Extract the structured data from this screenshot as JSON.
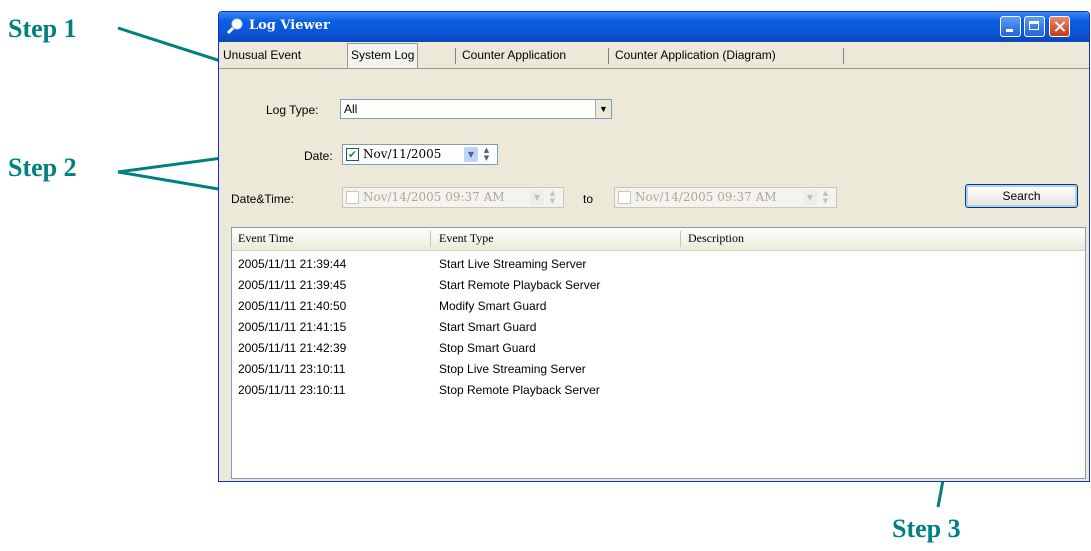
{
  "annotations": {
    "step1": "Step 1",
    "step2": "Step 2",
    "step3": "Step 3",
    "arrow_color": "#008080"
  },
  "window": {
    "title": "Log Viewer",
    "icon": "log-viewer-icon"
  },
  "tabs": [
    {
      "label": "Unusual Event"
    },
    {
      "label": "System Log"
    },
    {
      "label": "Counter Application"
    },
    {
      "label": "Counter Application (Diagram)"
    }
  ],
  "form": {
    "log_type_label": "Log Type:",
    "log_type_value": "All",
    "date_label": "Date:",
    "date_value": "Nov/11/2005",
    "datetime_label": "Date&Time:",
    "datetime_from": "Nov/14/2005 09:37 AM",
    "to_label": "to",
    "datetime_to": "Nov/14/2005 09:37 AM",
    "search_button": "Search"
  },
  "list": {
    "columns": [
      "Event Time",
      "Event Type",
      "Description"
    ],
    "rows": [
      [
        "2005/11/11 21:39:44",
        "Start Live Streaming Server",
        ""
      ],
      [
        "2005/11/11 21:39:45",
        "Start Remote Playback Server",
        ""
      ],
      [
        "2005/11/11 21:40:50",
        "Modify Smart Guard",
        ""
      ],
      [
        "2005/11/11 21:41:15",
        "Start Smart Guard",
        ""
      ],
      [
        "2005/11/11 21:42:39",
        "Stop Smart Guard",
        ""
      ],
      [
        "2005/11/11 23:10:11",
        "Stop Live Streaming Server",
        ""
      ],
      [
        "2005/11/11 23:10:11",
        "Stop Remote Playback Server",
        ""
      ]
    ]
  }
}
